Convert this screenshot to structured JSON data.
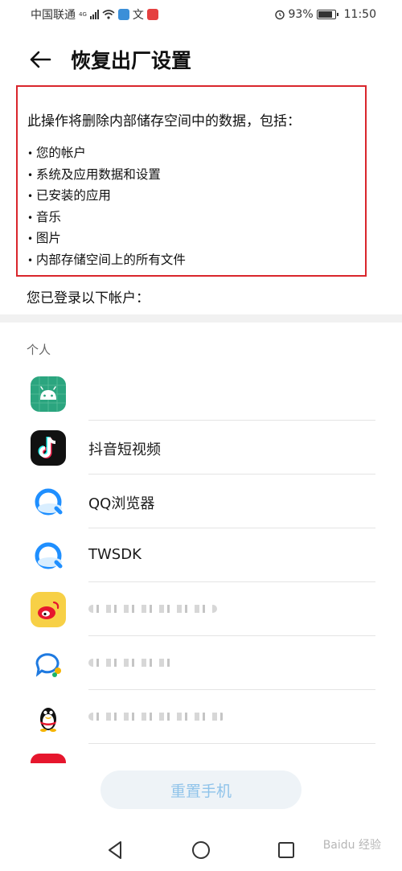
{
  "status_bar": {
    "carrier": "中国联通",
    "network": "4G",
    "battery": "93%",
    "time": "11:50"
  },
  "header": {
    "title": "恢复出厂设置"
  },
  "warning": {
    "heading": "此操作将删除内部储存空间中的数据，包括：",
    "items": [
      "您的帐户",
      "系统及应用数据和设置",
      "已安装的应用",
      "音乐",
      "图片",
      "内部存储空间上的所有文件"
    ]
  },
  "accounts_label": "您已登录以下帐户：",
  "section_label": "个人",
  "apps": [
    {
      "name": "",
      "icon": "android-icon"
    },
    {
      "name": "抖音短视频",
      "icon": "douyin-icon"
    },
    {
      "name": "QQ浏览器",
      "icon": "qq-browser-icon"
    },
    {
      "name": "TWSDK",
      "icon": "qq-browser-icon"
    },
    {
      "name": "",
      "icon": "weibo-icon"
    },
    {
      "name": "",
      "icon": "chat-bubble-icon"
    },
    {
      "name": "",
      "icon": "qq-penguin-icon"
    }
  ],
  "reset_button": "重置手机",
  "watermark": "Baidu 经验",
  "colors": {
    "accent_red": "#d9262c",
    "button_text": "#8fc3ea",
    "android_green": "#2ba57f"
  }
}
